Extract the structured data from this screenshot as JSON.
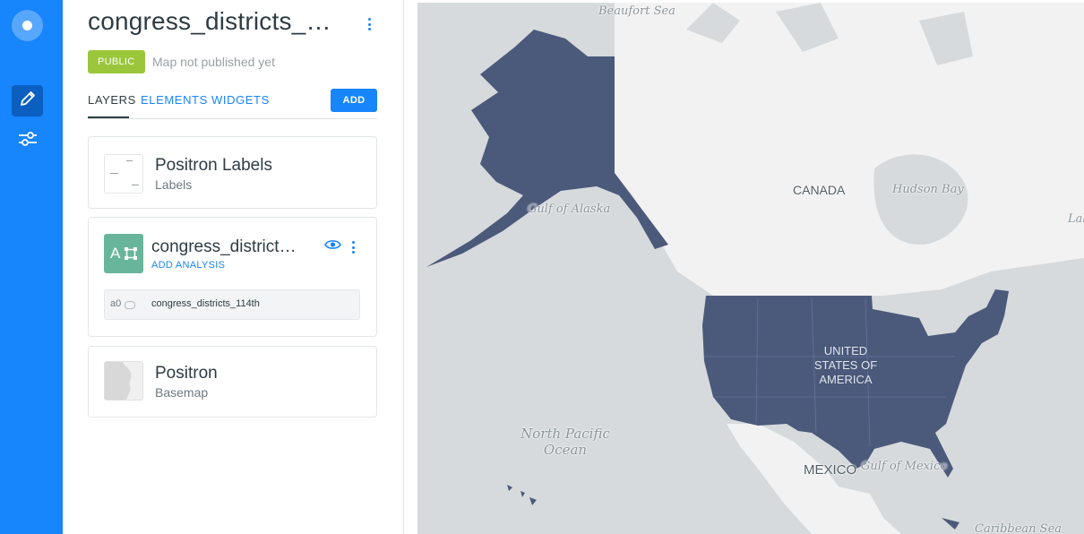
{
  "rail": {
    "items": [
      {
        "icon": "logo-icon"
      },
      {
        "icon": "pencil-icon",
        "active": true
      },
      {
        "icon": "sliders-icon",
        "active": false
      }
    ]
  },
  "panel": {
    "title": "congress_districts_1…",
    "title_menu_icon": "kebab-menu-icon",
    "badge": "PUBLIC",
    "publish_status": "Map not published yet",
    "tabs": [
      "LAYERS",
      "ELEMENTS",
      "WIDGETS"
    ],
    "active_tab": "LAYERS",
    "add_label": "ADD"
  },
  "layers": [
    {
      "title": "Positron Labels",
      "subtitle": "Labels"
    },
    {
      "title": "congress_districts_…",
      "thumb_letter": "A",
      "action": "ADD ANALYSIS",
      "source_id": "a0",
      "source_name": "congress_districts_114th"
    },
    {
      "title": "Positron",
      "subtitle": "Basemap"
    }
  ],
  "map": {
    "labels": {
      "beaufort": "Beaufort Sea",
      "gulf_alaska": "Gulf of Alaska",
      "canada": "CANADA",
      "hudson": "Hudson Bay",
      "lab": "Lab",
      "us_line1": "UNITED",
      "us_line2": "STATES OF",
      "us_line3": "AMERICA",
      "pacific_line1": "North Pacific",
      "pacific_line2": "Ocean",
      "mexico": "MEXICO",
      "gulf_mexico": "Gulf of Mexico",
      "caribbean": "Caribbean Sea"
    },
    "colors": {
      "water": "#d6dadc",
      "land": "#f2f2f2",
      "layer": "#4b5a7b"
    }
  }
}
